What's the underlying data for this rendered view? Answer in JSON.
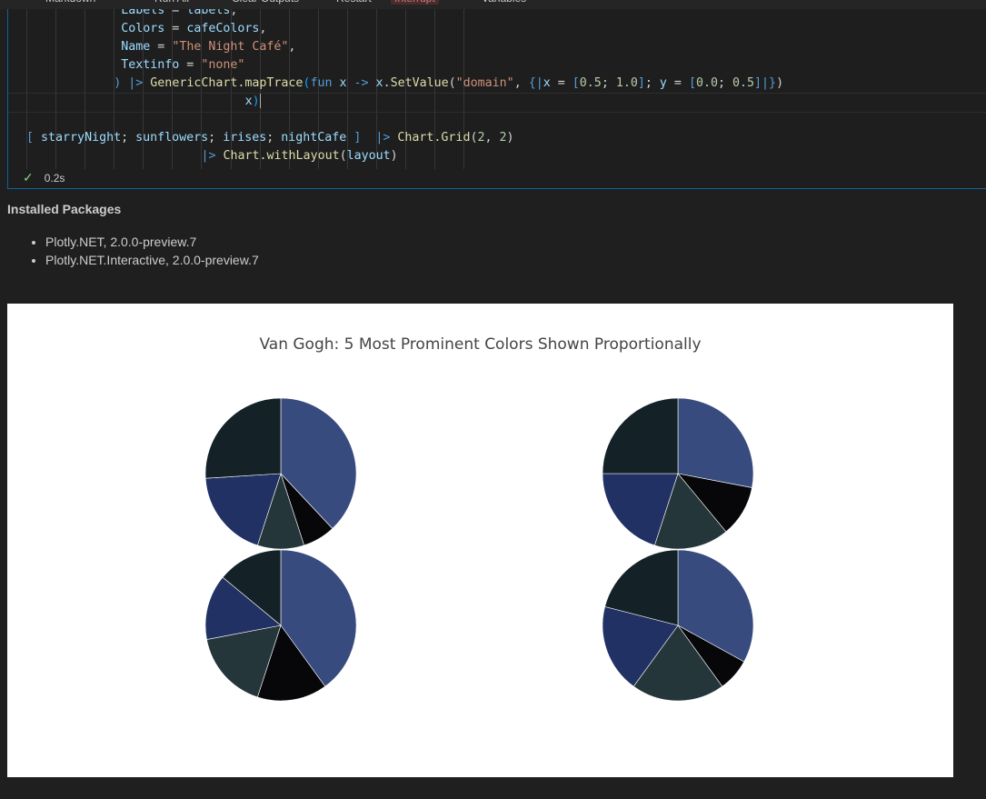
{
  "toolbar": {
    "items": [
      "Markdown",
      "Run All",
      "Clear Outputs",
      "Restart",
      "Interrupt",
      "Variables"
    ]
  },
  "code_lines": [
    {
      "indent": 13,
      "tokens": [
        [
          "var",
          "Labels"
        ],
        [
          "op",
          " = "
        ],
        [
          "var",
          "labels"
        ],
        [
          "op",
          ","
        ]
      ]
    },
    {
      "indent": 13,
      "tokens": [
        [
          "var",
          "Colors"
        ],
        [
          "op",
          " = "
        ],
        [
          "var",
          "cafeColors"
        ],
        [
          "op",
          ","
        ]
      ]
    },
    {
      "indent": 13,
      "tokens": [
        [
          "var",
          "Name"
        ],
        [
          "op",
          " = "
        ],
        [
          "str",
          "\"The Night Café\""
        ],
        [
          "op",
          ","
        ]
      ]
    },
    {
      "indent": 13,
      "tokens": [
        [
          "var",
          "Textinfo"
        ],
        [
          "op",
          " = "
        ],
        [
          "str",
          "\"none\""
        ]
      ]
    },
    {
      "indent": 12,
      "tokens": [
        [
          "kw",
          ")"
        ],
        [
          "op",
          " "
        ],
        [
          "kw",
          "|>"
        ],
        [
          "op",
          " "
        ],
        [
          "fn",
          "GenericChart.mapTrace"
        ],
        [
          "br",
          "("
        ],
        [
          "kw",
          "fun"
        ],
        [
          "op",
          " "
        ],
        [
          "var",
          "x"
        ],
        [
          "op",
          " "
        ],
        [
          "kw",
          "->"
        ],
        [
          "op",
          " "
        ],
        [
          "var",
          "x"
        ],
        [
          "op",
          "."
        ],
        [
          "fn",
          "SetValue"
        ],
        [
          "op",
          "("
        ],
        [
          "str",
          "\"domain\""
        ],
        [
          "op",
          ", "
        ],
        [
          "kw",
          "{|"
        ],
        [
          "var",
          "x"
        ],
        [
          "op",
          " = "
        ],
        [
          "kw",
          "["
        ],
        [
          "num",
          "0.5"
        ],
        [
          "op",
          "; "
        ],
        [
          "num",
          "1.0"
        ],
        [
          "kw",
          "]"
        ],
        [
          "op",
          "; "
        ],
        [
          "var",
          "y"
        ],
        [
          "op",
          " = "
        ],
        [
          "kw",
          "["
        ],
        [
          "num",
          "0.0"
        ],
        [
          "op",
          "; "
        ],
        [
          "num",
          "0.5"
        ],
        [
          "kw",
          "]|}"
        ],
        [
          "op",
          ")"
        ]
      ]
    },
    {
      "indent": 30,
      "tokens": [
        [
          "var",
          "x"
        ],
        [
          "br",
          ")"
        ]
      ],
      "cursor": true
    },
    {
      "indent": 0,
      "tokens": []
    },
    {
      "indent": 0,
      "tokens": [
        [
          "kw",
          "["
        ],
        [
          "op",
          " "
        ],
        [
          "var",
          "starryNight"
        ],
        [
          "op",
          "; "
        ],
        [
          "var",
          "sunflowers"
        ],
        [
          "op",
          "; "
        ],
        [
          "var",
          "irises"
        ],
        [
          "op",
          "; "
        ],
        [
          "var",
          "nightCafe"
        ],
        [
          "op",
          " "
        ],
        [
          "kw",
          "]"
        ],
        [
          "op",
          "  "
        ],
        [
          "kw",
          "|>"
        ],
        [
          "op",
          " "
        ],
        [
          "fn",
          "Chart.Grid"
        ],
        [
          "op",
          "("
        ],
        [
          "num",
          "2"
        ],
        [
          "op",
          ", "
        ],
        [
          "num",
          "2"
        ],
        [
          "op",
          ")"
        ]
      ]
    },
    {
      "indent": 24,
      "tokens": [
        [
          "kw",
          "|>"
        ],
        [
          "op",
          " "
        ],
        [
          "fn",
          "Chart.withLayout"
        ],
        [
          "op",
          "("
        ],
        [
          "var",
          "layout"
        ],
        [
          "op",
          ")"
        ]
      ]
    }
  ],
  "cell_status": {
    "check": "✓",
    "duration": "0.2s"
  },
  "installed": {
    "title": "Installed Packages",
    "packages": [
      "Plotly.NET, 2.0.0-preview.7",
      "Plotly.NET.Interactive, 2.0.0-preview.7"
    ]
  },
  "chart_data": {
    "type": "pie",
    "title": "Van Gogh: 5 Most Prominent Colors Shown Proportionally",
    "colors": [
      "#384b7e",
      "#07070a",
      "#25363a",
      "#223164",
      "#142228"
    ],
    "pies": [
      {
        "grid_position": "top-left",
        "values": [
          38,
          7,
          10,
          19,
          26
        ]
      },
      {
        "grid_position": "top-right",
        "values": [
          28,
          11,
          16,
          20,
          25
        ]
      },
      {
        "grid_position": "bottom-left",
        "values": [
          40,
          15,
          17,
          14,
          14
        ]
      },
      {
        "grid_position": "bottom-right",
        "values": [
          33,
          7,
          20,
          19,
          21
        ]
      }
    ]
  }
}
